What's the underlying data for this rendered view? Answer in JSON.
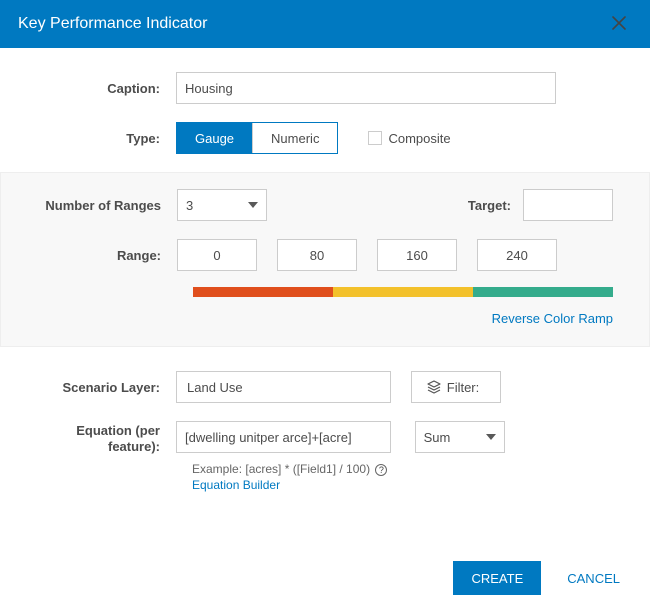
{
  "header": {
    "title": "Key Performance Indicator"
  },
  "labels": {
    "caption": "Caption:",
    "type": "Type:",
    "number_of_ranges": "Number of Ranges",
    "target": "Target:",
    "range": "Range:",
    "reverse_ramp": "Reverse Color Ramp",
    "scenario_layer": "Scenario Layer:",
    "equation": "Equation (per feature):",
    "filter": "Filter:",
    "composite": "Composite",
    "equation_example_prefix": "Example: ",
    "equation_builder": "Equation Builder"
  },
  "caption": {
    "value": "Housing"
  },
  "type": {
    "options": [
      "Gauge",
      "Numeric"
    ],
    "selected": "Gauge",
    "composite_checked": false
  },
  "ranges": {
    "count_selected": "3",
    "target_value": "",
    "values": [
      "0",
      "80",
      "160",
      "240"
    ],
    "ramp_colors": [
      "#e04f1d",
      "#f3c12b",
      "#35ac8c"
    ]
  },
  "scenario": {
    "layer_selected": "Land Use",
    "filter_label": "Filter:"
  },
  "equation": {
    "value": "[dwelling unitper arce]+[acre]",
    "aggregate_selected": "Sum",
    "example": "[acres] * ([Field1] / 100)"
  },
  "footer": {
    "create": "CREATE",
    "cancel": "CANCEL"
  }
}
